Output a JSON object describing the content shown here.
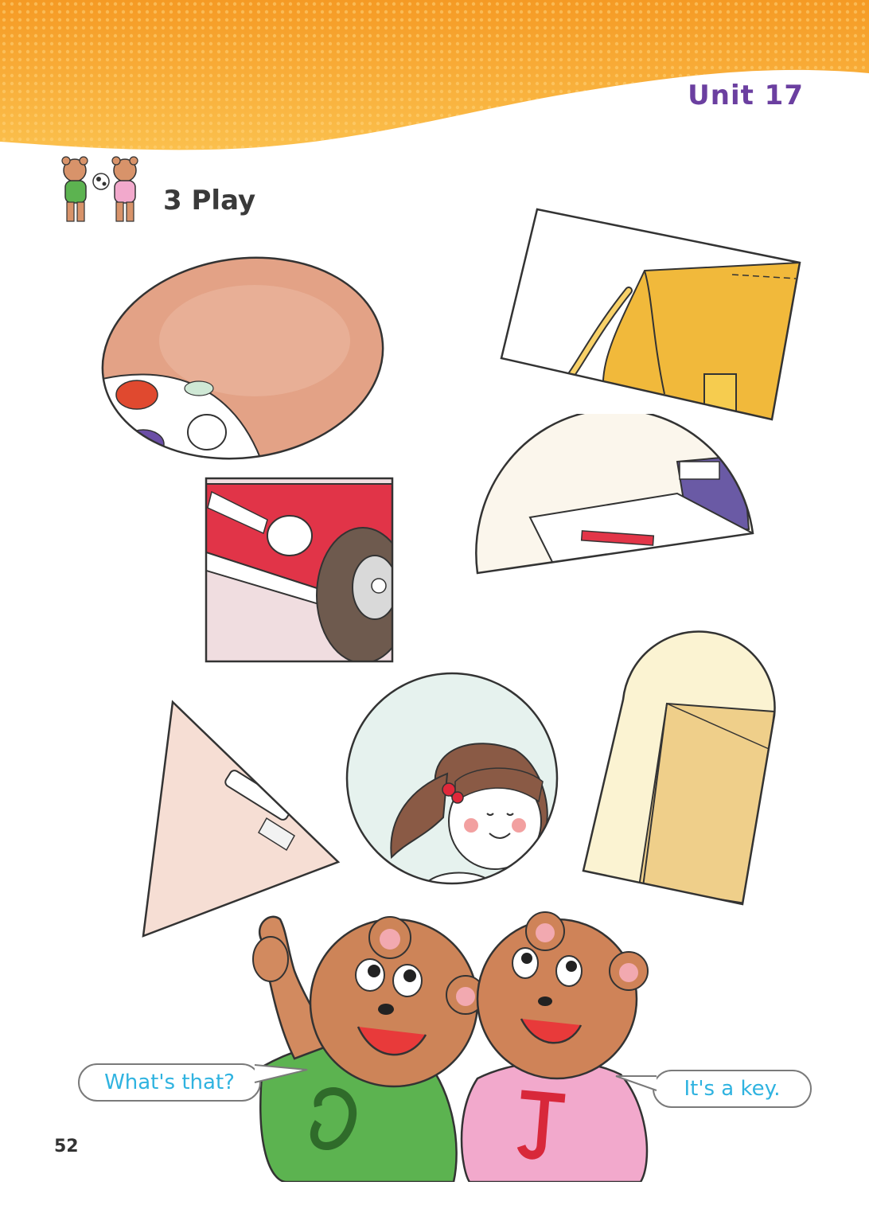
{
  "header": {
    "unit_title": "Unit 17"
  },
  "section": {
    "title": "3 Play",
    "icon": "bear-friends-ball-icon"
  },
  "puzzle_shapes": [
    {
      "shape": "oval",
      "depicts": "ball"
    },
    {
      "shape": "rectangle",
      "depicts": "bag"
    },
    {
      "shape": "square",
      "depicts": "car"
    },
    {
      "shape": "semicircle",
      "depicts": "boat"
    },
    {
      "shape": "triangle",
      "depicts": "key"
    },
    {
      "shape": "circle",
      "depicts": "girl"
    },
    {
      "shape": "arch",
      "depicts": "door"
    }
  ],
  "dialogue": {
    "question": "What's that?",
    "answer": "It's a key."
  },
  "footer": {
    "page_number": "52"
  },
  "colors": {
    "banner": "#f7a534",
    "unit_title": "#6b3fa0",
    "bubble_text": "#2fb3e0",
    "bear_b_shirt": "#5cb350",
    "bear_j_shirt": "#f2a9cc"
  }
}
